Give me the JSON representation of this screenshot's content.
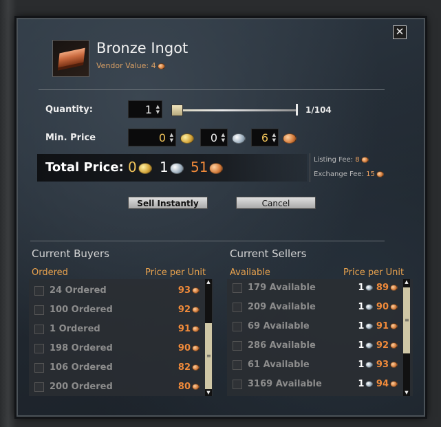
{
  "window": {
    "close_label": "✕"
  },
  "item": {
    "name": "Bronze Ingot",
    "vendor_label": "Vendor Value:",
    "vendor_value": "4"
  },
  "quantity": {
    "label": "Quantity:",
    "value": "1",
    "max_text": "1/104",
    "slider_fraction": 0.0
  },
  "min_price": {
    "label": "Min. Price",
    "gold": "0",
    "silver": "0",
    "copper": "6"
  },
  "total": {
    "label": "Total Price:",
    "gold": "0",
    "silver": "1",
    "copper": "51"
  },
  "fees": {
    "listing_label": "Listing Fee:",
    "listing_value": "8",
    "exchange_label": "Exchange Fee:",
    "exchange_value": "15"
  },
  "buttons": {
    "sell": "Sell Instantly",
    "cancel": "Cancel"
  },
  "buyers": {
    "title": "Current Buyers",
    "col_left": "Ordered",
    "col_right": "Price per Unit",
    "rows": [
      {
        "text": "24 Ordered",
        "price": "93"
      },
      {
        "text": "100 Ordered",
        "price": "92"
      },
      {
        "text": "1 Ordered",
        "price": "91"
      },
      {
        "text": "198 Ordered",
        "price": "90"
      },
      {
        "text": "106 Ordered",
        "price": "82"
      },
      {
        "text": "200 Ordered",
        "price": "80"
      }
    ]
  },
  "sellers": {
    "title": "Current Sellers",
    "col_left": "Available",
    "col_right": "Price per Unit",
    "rows": [
      {
        "text": "179 Available",
        "silver": "1",
        "price": "89"
      },
      {
        "text": "209 Available",
        "silver": "1",
        "price": "90"
      },
      {
        "text": "69 Available",
        "silver": "1",
        "price": "91"
      },
      {
        "text": "286 Available",
        "silver": "1",
        "price": "92"
      },
      {
        "text": "61 Available",
        "silver": "1",
        "price": "93"
      },
      {
        "text": "3169 Available",
        "silver": "1",
        "price": "94"
      }
    ]
  },
  "colors": {
    "accent_orange": "#e8a24e",
    "copper_text": "#f08a3a",
    "gold_text": "#f1c45a"
  },
  "icons": [
    "close-icon",
    "gold-coin-icon",
    "silver-coin-icon",
    "copper-coin-icon",
    "scroll-up-icon",
    "scroll-down-icon"
  ]
}
